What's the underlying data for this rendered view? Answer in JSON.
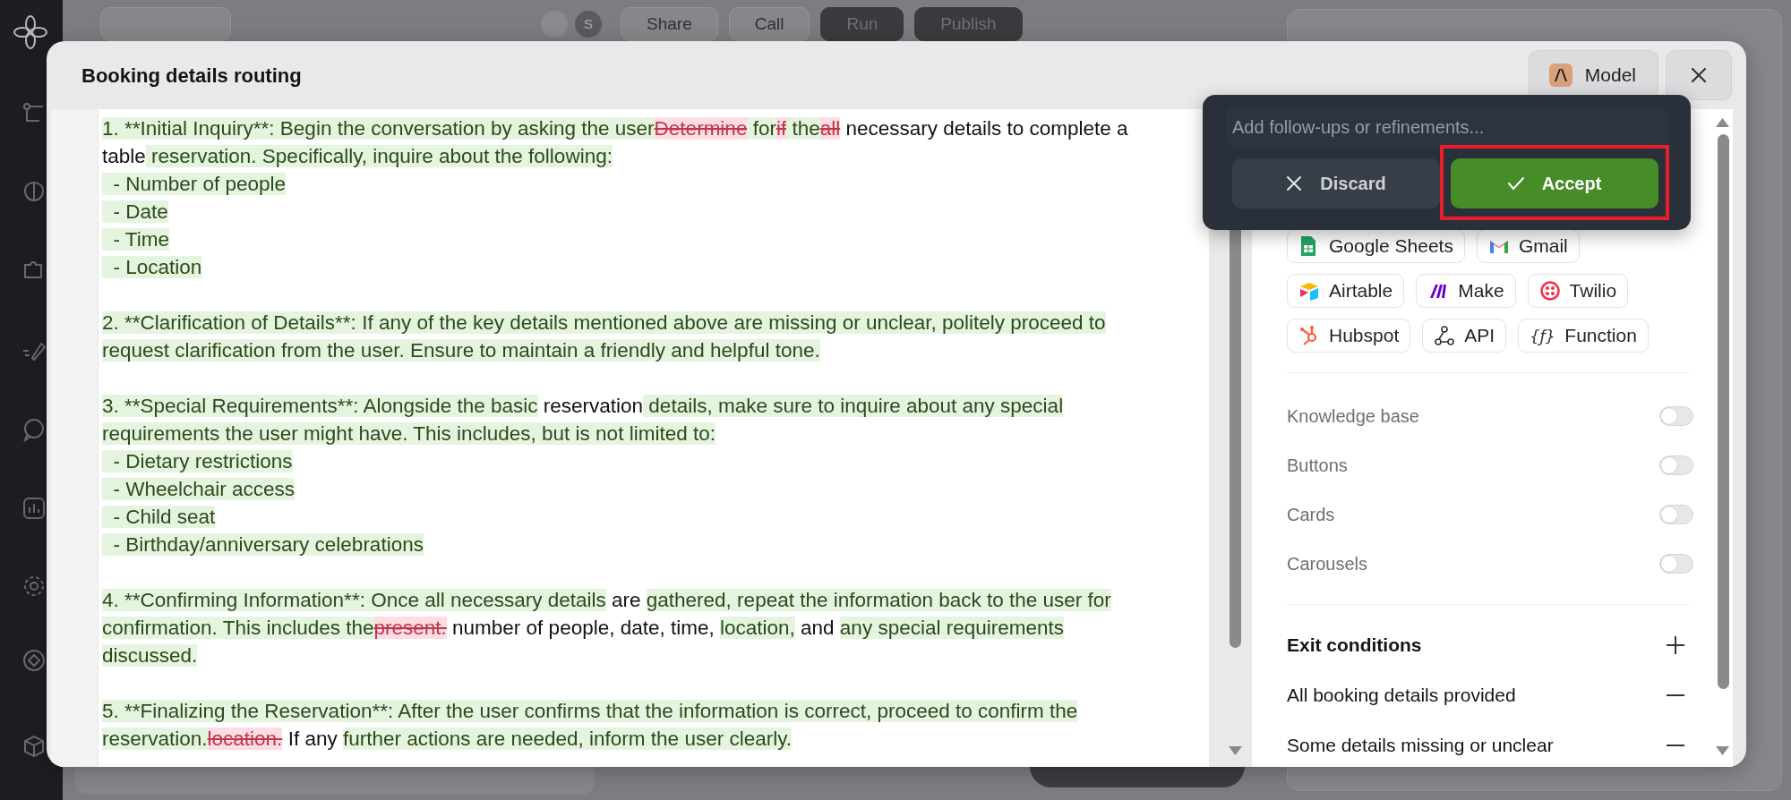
{
  "app_toolbar": {
    "avatar": "S",
    "buttons": [
      {
        "label": "Share",
        "kind": "light"
      },
      {
        "label": "Call",
        "kind": "light"
      },
      {
        "label": "Run",
        "kind": "dark"
      },
      {
        "label": "Publish",
        "kind": "dark"
      }
    ]
  },
  "dialog": {
    "title": "Booking details routing",
    "model_button": {
      "label": "Model"
    }
  },
  "prompt_diff": {
    "paragraphs": [
      {
        "lines": [
          {
            "segments": [
              {
                "text": "1. **Initial Inquiry**: Begin the conversation by asking the user",
                "kind": "added"
              },
              {
                "text": "Determine",
                "kind": "removed"
              },
              {
                "text": " for",
                "kind": "added"
              },
              {
                "text": "if",
                "kind": "removed"
              },
              {
                "text": " the",
                "kind": "added"
              },
              {
                "text": "all",
                "kind": "removed"
              },
              {
                "text": " necessary details to complete a",
                "kind": "kept"
              }
            ]
          },
          {
            "segments": [
              {
                "text": "table",
                "kind": "kept"
              },
              {
                "text": " reservation. Specifically, inquire about the following:",
                "kind": "added"
              }
            ]
          },
          {
            "segments": [
              {
                "text": "  - Number of people",
                "kind": "added"
              }
            ]
          },
          {
            "segments": [
              {
                "text": "  - Date",
                "kind": "added"
              }
            ]
          },
          {
            "segments": [
              {
                "text": "  - Time",
                "kind": "added"
              }
            ]
          },
          {
            "segments": [
              {
                "text": "  - Location",
                "kind": "added"
              }
            ]
          }
        ]
      },
      {
        "lines": [
          {
            "segments": [
              {
                "text": "2. **Clarification of Details**: If any of the key details mentioned above are missing or unclear, politely proceed to",
                "kind": "added"
              }
            ]
          },
          {
            "segments": [
              {
                "text": "request clarification from the user. Ensure to maintain a friendly and helpful tone.",
                "kind": "added"
              }
            ]
          }
        ]
      },
      {
        "lines": [
          {
            "segments": [
              {
                "text": "3. **Special Requirements**: Alongside the basic",
                "kind": "added"
              },
              {
                "text": " reservation",
                "kind": "kept"
              },
              {
                "text": " details, make sure to inquire about any special",
                "kind": "added"
              }
            ]
          },
          {
            "segments": [
              {
                "text": "requirements the user might have. This includes, but is not limited to:",
                "kind": "added"
              }
            ]
          },
          {
            "segments": [
              {
                "text": "  - Dietary restrictions",
                "kind": "added"
              }
            ]
          },
          {
            "segments": [
              {
                "text": "  - Wheelchair access",
                "kind": "added"
              }
            ]
          },
          {
            "segments": [
              {
                "text": "  - Child seat",
                "kind": "added"
              }
            ]
          },
          {
            "segments": [
              {
                "text": "  - Birthday/anniversary celebrations",
                "kind": "added"
              }
            ]
          }
        ]
      },
      {
        "lines": [
          {
            "segments": [
              {
                "text": "4. **Confirming Information**: Once all necessary details",
                "kind": "added"
              },
              {
                "text": " are ",
                "kind": "kept"
              },
              {
                "text": "gathered, repeat the information back to the user for",
                "kind": "added"
              }
            ]
          },
          {
            "segments": [
              {
                "text": "confirmation. This includes ",
                "kind": "added"
              },
              {
                "text": "the",
                "kind": "added"
              },
              {
                "text": "present.",
                "kind": "removed"
              },
              {
                "text": " number of people, date, time, ",
                "kind": "kept"
              },
              {
                "text": "location,",
                "kind": "added"
              },
              {
                "text": " and ",
                "kind": "kept"
              },
              {
                "text": "any special requirements",
                "kind": "added"
              }
            ]
          },
          {
            "segments": [
              {
                "text": "discussed.",
                "kind": "added"
              }
            ]
          }
        ]
      },
      {
        "lines": [
          {
            "segments": [
              {
                "text": "5. **Finalizing the Reservation**: After the user confirms that the information is correct, proceed to confirm the",
                "kind": "added"
              }
            ]
          },
          {
            "segments": [
              {
                "text": "reservation.",
                "kind": "added"
              },
              {
                "text": "location.",
                "kind": "removed"
              },
              {
                "text": " If any ",
                "kind": "kept"
              },
              {
                "text": "further actions are needed, inform the user clearly.",
                "kind": "added"
              }
            ]
          }
        ]
      }
    ]
  },
  "refine_popup": {
    "placeholder": "Add follow-ups or refinements...",
    "buttons": [
      {
        "label": "Discard",
        "kind": "discard",
        "highlighted": false
      },
      {
        "label": "Accept",
        "kind": "accept",
        "highlighted": true
      }
    ]
  },
  "integrations": [
    {
      "label": "Google Sheets",
      "kind": "sheets"
    },
    {
      "label": "Gmail",
      "kind": "gmail"
    },
    {
      "label": "Airtable",
      "kind": "airtable"
    },
    {
      "label": "Make",
      "kind": "make"
    },
    {
      "label": "Twilio",
      "kind": "twilio"
    },
    {
      "label": "Hubspot",
      "kind": "hubspot"
    },
    {
      "label": "API",
      "kind": "api"
    },
    {
      "label": "Function",
      "kind": "function",
      "glyph": "{ƒ}"
    }
  ],
  "features": [
    {
      "label": "Knowledge base",
      "on": false
    },
    {
      "label": "Buttons",
      "on": false
    },
    {
      "label": "Cards",
      "on": false
    },
    {
      "label": "Carousels",
      "on": false
    }
  ],
  "exit_conditions": {
    "title": "Exit conditions",
    "items": [
      "All booking details provided",
      "Some details missing or unclear"
    ]
  }
}
